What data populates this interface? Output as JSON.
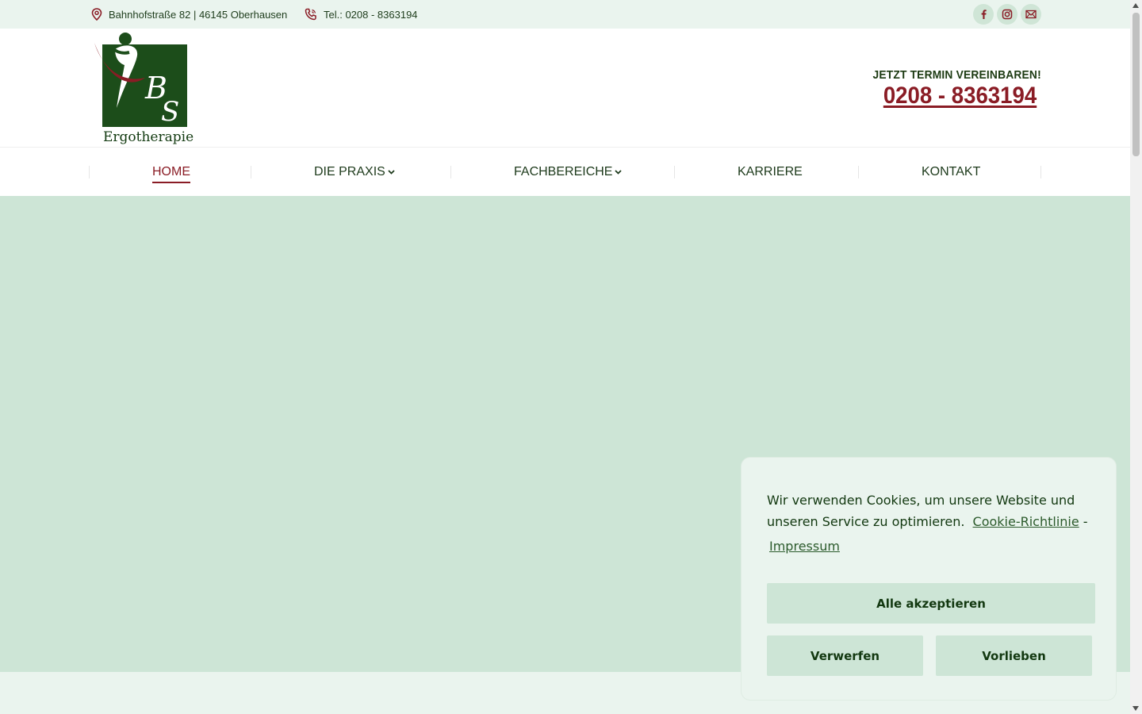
{
  "topbar": {
    "address": "Bahnhofstraße 82 | 46145 Oberhausen",
    "phone": "Tel.: 0208 - 8363194",
    "social_icons": [
      "facebook-icon",
      "instagram-icon",
      "mail-icon"
    ]
  },
  "header": {
    "logo_text": "Ergotherapie",
    "logo_monogram": "BS",
    "cta_title": "JETZT TERMIN VEREINBAREN!",
    "cta_phone": "0208 - 8363194"
  },
  "nav": {
    "items": [
      {
        "label": "HOME",
        "active": true,
        "has_dropdown": false
      },
      {
        "label": "DIE PRAXIS",
        "active": false,
        "has_dropdown": true
      },
      {
        "label": "FACHBEREICHE",
        "active": false,
        "has_dropdown": true
      },
      {
        "label": "KARRIERE",
        "active": false,
        "has_dropdown": false
      },
      {
        "label": "KONTAKT",
        "active": false,
        "has_dropdown": false
      }
    ]
  },
  "cookie": {
    "message": "Wir verwenden Cookies, um unsere Website und unseren Service zu optimieren.",
    "link_policy": "Cookie-Richtlinie",
    "separator": "-",
    "link_imprint": "Impressum",
    "accept_label": "Alle akzeptieren",
    "deny_label": "Verwerfen",
    "prefs_label": "Vorlieben"
  },
  "colors": {
    "brand_green": "#1c4d1a",
    "brand_red": "#8a1c25",
    "hero_bg": "#cde5d6",
    "topbar_bg": "#eaf4ee"
  }
}
